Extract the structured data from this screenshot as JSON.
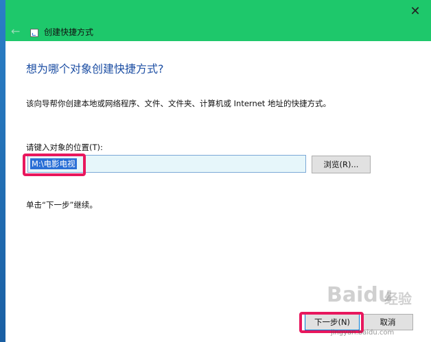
{
  "window": {
    "title": "创建快捷方式",
    "close_glyph": "✕",
    "back_glyph": "←"
  },
  "content": {
    "heading": "想为哪个对象创建快捷方式?",
    "description": "该向导帮你创建本地或网络程序、文件、文件夹、计算机或 Internet 地址的快捷方式。",
    "location_label": "请键入对象的位置(T):",
    "location_value": "M:\\电影电视",
    "browse_label": "浏览(R)...",
    "hint": "单击“下一步”继续。"
  },
  "footer": {
    "next_label": "下一步(N)",
    "cancel_label": "取消"
  },
  "watermark": {
    "logo": "Baidu",
    "logo_cn": "经验",
    "url": "jingyan.baidu.com"
  },
  "colors": {
    "titlebar": "#1ec86b",
    "heading": "#1c4ea3",
    "highlight": "#e8175d",
    "selection": "#2a6fd6"
  }
}
